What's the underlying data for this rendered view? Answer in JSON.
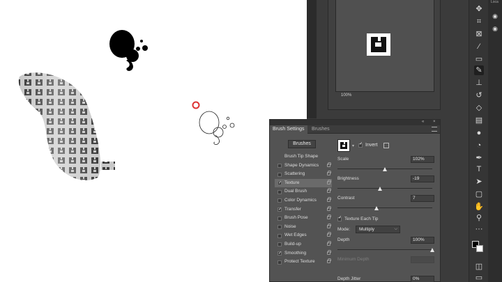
{
  "navigator": {
    "zoom": "100%"
  },
  "right_strip": {
    "label": "Loca"
  },
  "tool_icons": [
    "move-icon",
    "crop-icon",
    "frame-icon",
    "eyedropper-icon",
    "healing-brush-icon",
    "brush-icon",
    "clone-stamp-icon",
    "history-brush-icon",
    "eraser-icon",
    "gradient-icon",
    "blur-icon",
    "dodge-icon",
    "pen-icon",
    "type-icon",
    "path-selection-icon",
    "rectangle-icon",
    "hand-icon",
    "zoom-icon",
    "more-tools-icon"
  ],
  "panel": {
    "tabs": [
      "Brush Settings",
      "Brushes"
    ],
    "brushes_button": "Brushes",
    "options": [
      {
        "label": "Brush Tip Shape",
        "checkbox": false,
        "checked": false,
        "lock": false,
        "active": false
      },
      {
        "label": "Shape Dynamics",
        "checkbox": true,
        "checked": false,
        "lock": true,
        "active": false
      },
      {
        "label": "Scattering",
        "checkbox": true,
        "checked": false,
        "lock": true,
        "active": false
      },
      {
        "label": "Texture",
        "checkbox": true,
        "checked": true,
        "lock": true,
        "active": true
      },
      {
        "label": "Dual Brush",
        "checkbox": true,
        "checked": false,
        "lock": true,
        "active": false
      },
      {
        "label": "Color Dynamics",
        "checkbox": true,
        "checked": false,
        "lock": true,
        "active": false
      },
      {
        "label": "Transfer",
        "checkbox": true,
        "checked": true,
        "lock": true,
        "active": false
      },
      {
        "label": "Brush Pose",
        "checkbox": true,
        "checked": false,
        "lock": true,
        "active": false
      },
      {
        "label": "Noise",
        "checkbox": true,
        "checked": false,
        "lock": true,
        "active": false
      },
      {
        "label": "Wet Edges",
        "checkbox": true,
        "checked": false,
        "lock": true,
        "active": false
      },
      {
        "label": "Build-up",
        "checkbox": true,
        "checked": false,
        "lock": true,
        "active": false
      },
      {
        "label": "Smoothing",
        "checkbox": true,
        "checked": true,
        "lock": true,
        "active": false
      },
      {
        "label": "Protect Texture",
        "checkbox": true,
        "checked": false,
        "lock": true,
        "active": false
      }
    ],
    "invert_label": "Invert",
    "invert_checked": true,
    "scale": {
      "label": "Scale",
      "value": "102%",
      "level": 0.5
    },
    "brightness": {
      "label": "Brightness",
      "value": "-19",
      "level": 0.45
    },
    "contrast": {
      "label": "Contrast",
      "value": "7",
      "level": 0.41
    },
    "texture_each_tip": {
      "label": "Texture Each Tip",
      "checked": true
    },
    "mode": {
      "label": "Mode:",
      "value": "Multiply"
    },
    "depth": {
      "label": "Depth",
      "value": "100%",
      "level": 1.0
    },
    "minimum_depth": {
      "label": "Minimum Depth",
      "value": ""
    },
    "depth_jitter": {
      "label": "Depth Jitter",
      "value": "0%"
    }
  }
}
